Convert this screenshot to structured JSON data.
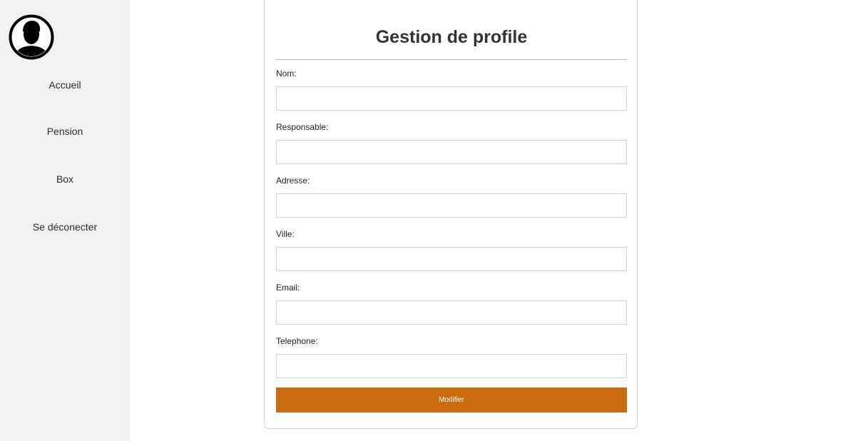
{
  "sidebar": {
    "avatar_icon": "user-silhouette-icon",
    "items": [
      {
        "label": "Accueil"
      },
      {
        "label": "Pension"
      },
      {
        "label": "Box"
      },
      {
        "label": "Se déconecter"
      }
    ]
  },
  "form": {
    "title": "Gestion de profile",
    "fields": [
      {
        "label": "Nom:",
        "value": ""
      },
      {
        "label": "Responsable:",
        "value": ""
      },
      {
        "label": "Adresse:",
        "value": ""
      },
      {
        "label": "Ville:",
        "value": ""
      },
      {
        "label": "Email:",
        "value": ""
      },
      {
        "label": "Telephone:",
        "value": ""
      }
    ],
    "submit_label": "Modifier"
  },
  "colors": {
    "sidebar_bg": "#f2f2f2",
    "button_bg": "#cc6a10",
    "button_text": "#ffffff"
  }
}
